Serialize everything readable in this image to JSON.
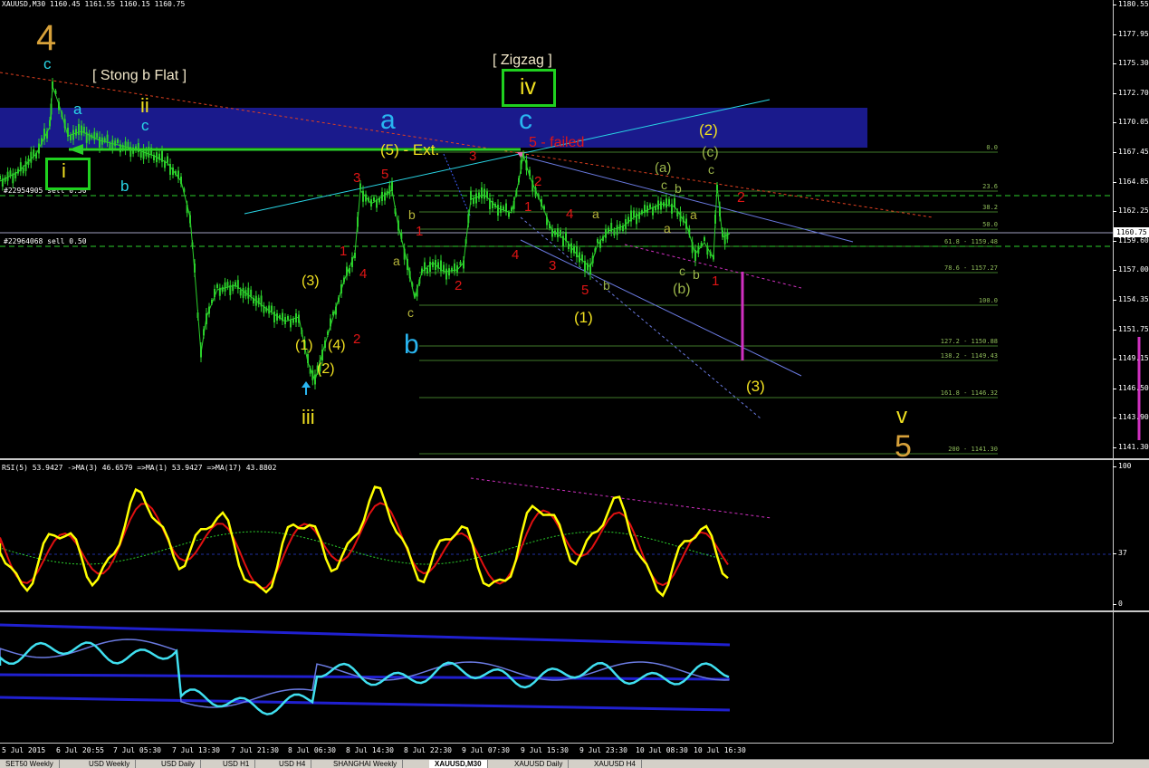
{
  "header": {
    "symbol_line": "XAUUSD,M30  1160.45 1161.55 1160.15 1160.75",
    "order1": "#22954905 sell 0.50",
    "order2": "#22964068 sell 0.50"
  },
  "price_axis": {
    "ticks": [
      "1180.55",
      "1177.95",
      "1175.30",
      "1172.70",
      "1170.05",
      "1167.45",
      "1164.85",
      "1162.25",
      "1159.60",
      "1157.00",
      "1154.35",
      "1151.75",
      "1149.15",
      "1146.50",
      "1143.90",
      "1141.30"
    ],
    "current": "1160.75"
  },
  "annotations": {
    "wave4_big": "4",
    "c_top": "c",
    "a_left": "a",
    "strong_b_flat": "[ Stong b Flat ]",
    "ii": "ii",
    "c_ii": "c",
    "b_left": "b",
    "i": "i",
    "zigzag": "[ Zigzag ]",
    "iv": "iv",
    "big_a": "a",
    "big_c": "c",
    "five_ext": "(5) - Ext.",
    "five_failed": "5 - failed",
    "big_b": "b",
    "iii": "iii",
    "p3": "(3)",
    "p1": "(1)",
    "p4": "(4)",
    "p2": "(2)",
    "r1a": "1",
    "r2a": "2",
    "r3a": "3",
    "r4a": "4",
    "r5a": "5",
    "r3b": "3",
    "r1b": "1",
    "r2b": "2",
    "r1c": "1",
    "r2c": "2",
    "r4b": "4",
    "r3c": "3",
    "r4c": "4",
    "r5b": "5",
    "r1d": "1",
    "r2d": "2",
    "g_b1": "b",
    "g_a1": "a",
    "g_c1": "c",
    "g_a2": "a",
    "g_b2": "b",
    "g_a3": "a",
    "g_c2": "c",
    "g_b3": "b",
    "g_a4": "a",
    "g_a5": "(a)",
    "g_c3": "c",
    "g_b4": "b",
    "g_c4": "c",
    "g_b5": "b",
    "g_bb": "(b)",
    "g_cc": "(c)",
    "g_c5": "c",
    "y_2": "(2)",
    "y_1": "(1)",
    "y_3": "(3)",
    "v": "v",
    "five_big": "5"
  },
  "fib_levels": [
    {
      "label": "0.0"
    },
    {
      "label": "23.6"
    },
    {
      "label": "38.2"
    },
    {
      "label": "50.0"
    },
    {
      "label": "61.8 - 1159.48"
    },
    {
      "label": "78.6 - 1157.27"
    },
    {
      "label": "100.0"
    },
    {
      "label": "127.2 - 1150.88"
    },
    {
      "label": "138.2 - 1149.43"
    },
    {
      "label": "161.8 - 1146.32"
    },
    {
      "label": "200 - 1141.30"
    }
  ],
  "rsi": {
    "label": "RSI(5) 53.9427  ->MA(3) 46.6579  =>MA(1) 53.9427  =>MA(17) 43.8802",
    "ticks": [
      "100",
      "37",
      "0"
    ]
  },
  "time_axis": [
    "5 Jul 2015",
    "6 Jul 20:55",
    "7 Jul 05:30",
    "7 Jul 13:30",
    "7 Jul 21:30",
    "8 Jul 06:30",
    "8 Jul 14:30",
    "8 Jul 22:30",
    "9 Jul 07:30",
    "9 Jul 15:30",
    "9 Jul 23:30",
    "10 Jul 08:30",
    "10 Jul 16:30"
  ],
  "tabs": [
    "SET50 Weekly",
    "USD Weekly",
    "USD Daily",
    "USD H1",
    "USD H4",
    "SHANGHAI Weekly",
    "XAUUSD,M30",
    "XAUUSD Daily",
    "XAUUSD H4"
  ],
  "active_tab": "XAUUSD,M30",
  "colors": {
    "candle": "#2bd02b",
    "zone": "#1a1a8c",
    "rsi_line": "#ffff00",
    "rsi_ma": "#e01010",
    "cyan": "#29d6e6",
    "orange": "#d7a13a",
    "red": "#e01515",
    "yellow": "#f0e020",
    "olive": "#9bb54a",
    "magenta": "#d030c0"
  }
}
